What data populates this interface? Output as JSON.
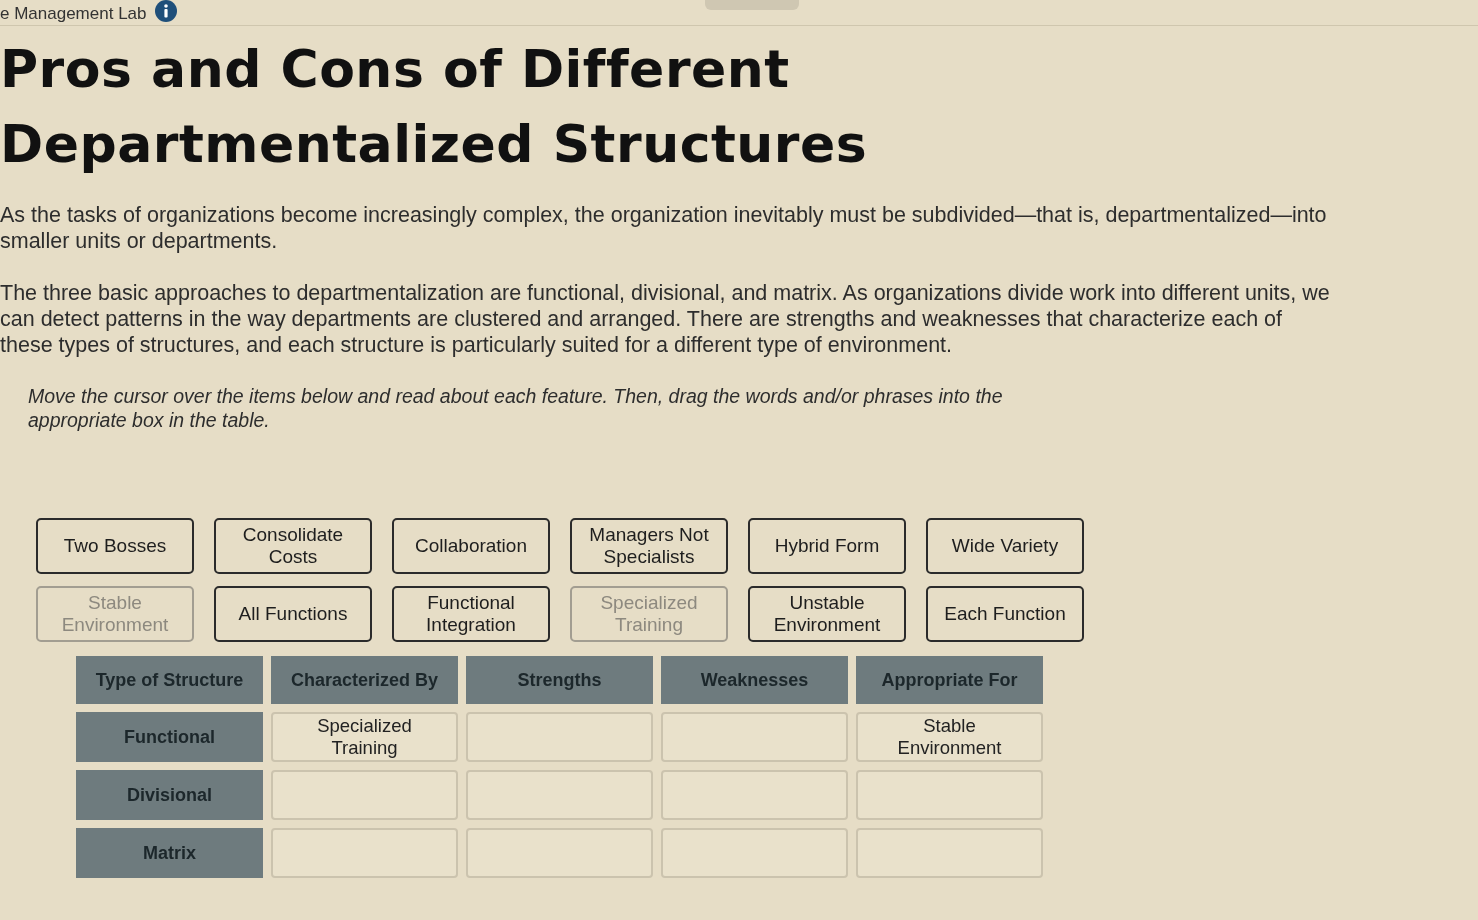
{
  "header": {
    "title": "e Management Lab"
  },
  "page_title": "Pros and Cons of Different Departmentalized Structures",
  "paragraphs": [
    "As the tasks of organizations become increasingly complex, the organization inevitably must be subdivided—that is, departmentalized—into smaller units or departments.",
    "The three basic approaches to departmentalization are functional, divisional, and matrix. As organizations divide work into different units, we can detect patterns in the way departments are clustered and arranged. There are strengths and weaknesses that characterize each of these types of structures, and each structure is particularly suited for a different type of environment."
  ],
  "instructions": "Move the cursor over the items below and read about each feature. Then, drag the words and/or phrases into the appropriate box in the table.",
  "chips": [
    {
      "label": "Two Bosses",
      "placed": false
    },
    {
      "label": "Consolidate Costs",
      "placed": false
    },
    {
      "label": "Collaboration",
      "placed": false
    },
    {
      "label": "Managers Not Specialists",
      "placed": false
    },
    {
      "label": "Hybrid Form",
      "placed": false
    },
    {
      "label": "Wide Variety",
      "placed": false
    },
    {
      "label": "Stable Environment",
      "placed": true
    },
    {
      "label": "All Functions",
      "placed": false
    },
    {
      "label": "Functional Integration",
      "placed": false
    },
    {
      "label": "Specialized Training",
      "placed": true
    },
    {
      "label": "Unstable Environment",
      "placed": false
    },
    {
      "label": "Each Function",
      "placed": false
    }
  ],
  "table": {
    "columns": [
      "Type of Structure",
      "Characterized By",
      "Strengths",
      "Weaknesses",
      "Appropriate For"
    ],
    "rows": [
      {
        "type": "Functional",
        "characterized_by": "Specialized Training",
        "appropriate_for": "Stable Environment"
      },
      {
        "type": "Divisional"
      },
      {
        "type": "Matrix"
      }
    ]
  }
}
